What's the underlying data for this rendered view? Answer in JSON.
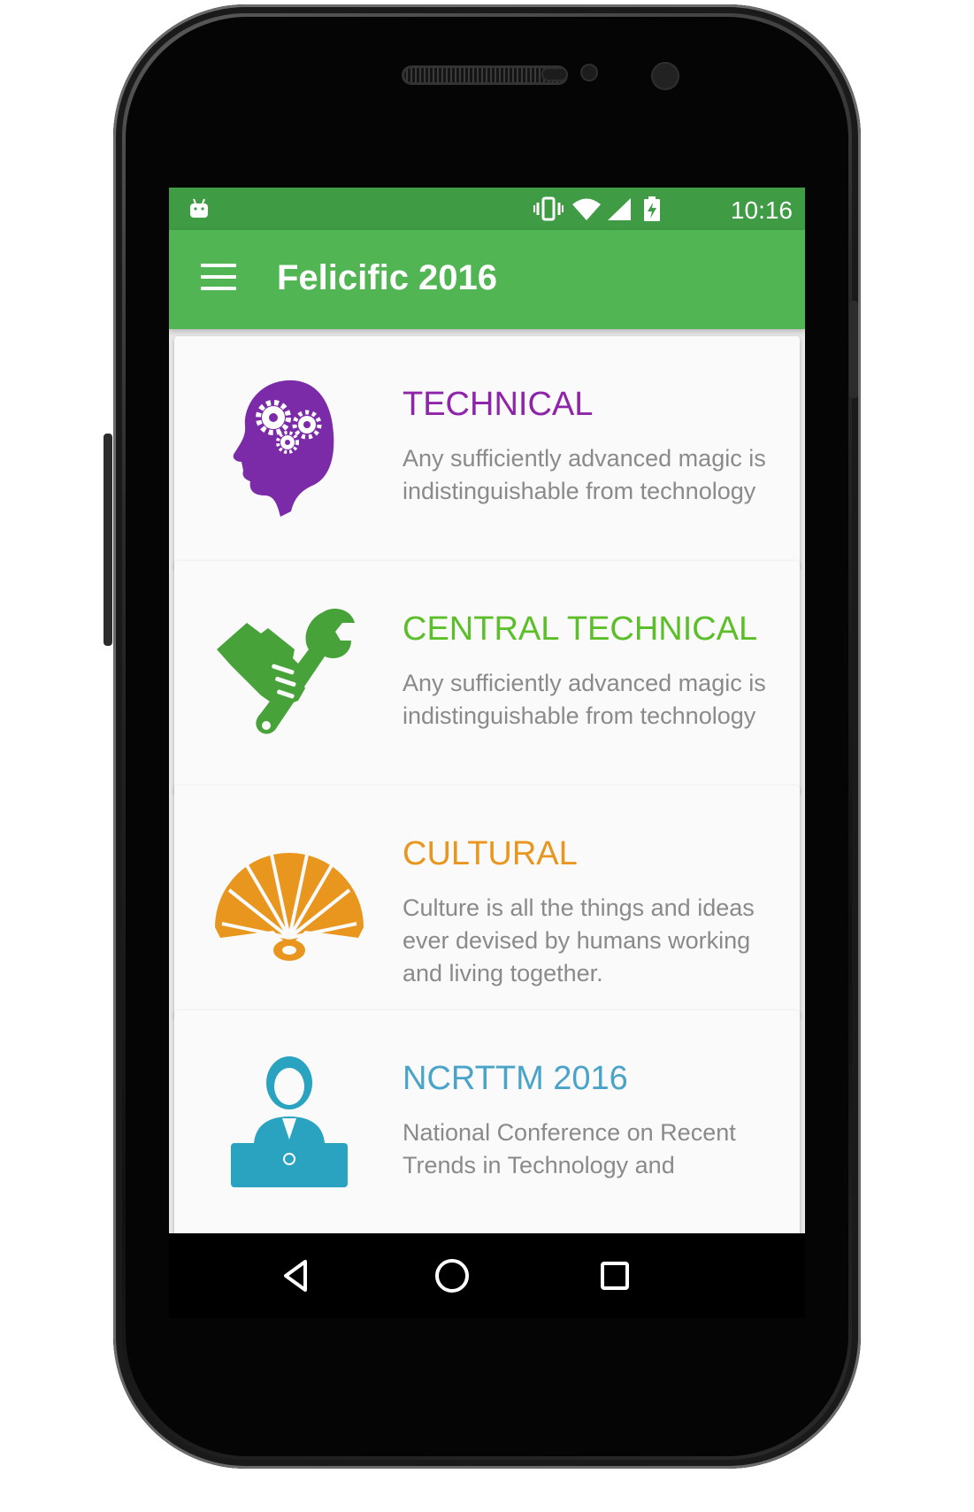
{
  "status_bar": {
    "time": "10:16",
    "icons": [
      "android-debug-icon",
      "vibrate-icon",
      "wifi-icon",
      "cell-signal-icon",
      "battery-charging-icon"
    ]
  },
  "app_bar": {
    "title": "Felicific 2016",
    "menu_icon": "hamburger-menu-icon"
  },
  "cards": [
    {
      "title": "TECHNICAL",
      "description": "Any sufficiently advanced magic is indistinguishable from technology",
      "color": "#8e24aa",
      "icon": "brain-gears-icon"
    },
    {
      "title": "CENTRAL TECHNICAL",
      "description": "Any sufficiently advanced magic is indistinguishable from technology",
      "color": "#5cbf2a",
      "icon": "hand-wrench-icon"
    },
    {
      "title": "CULTURAL",
      "description": "Culture is all the things and ideas ever devised by humans working and living together.",
      "color": "#e8961e",
      "icon": "hand-fan-icon"
    },
    {
      "title": "NCRTTM 2016",
      "description": "National Conference on Recent Trends in Technology and",
      "color": "#4aa3c8",
      "icon": "speaker-podium-icon"
    }
  ],
  "nav_bar": {
    "buttons": [
      "back-icon",
      "home-icon",
      "recents-icon"
    ]
  },
  "colors": {
    "status_bar": "#3f9b44",
    "app_bar": "#52b554",
    "card_background": "#fafafa",
    "description_text": "#8a8a8a"
  }
}
